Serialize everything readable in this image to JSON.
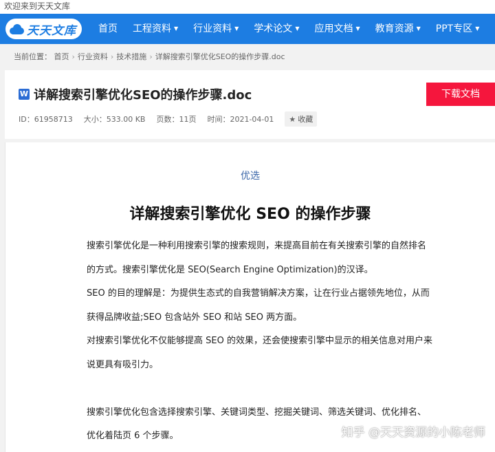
{
  "welcome": "欢迎来到天天文库",
  "logo": {
    "text": "天天文库"
  },
  "nav": [
    {
      "label": "首页",
      "caret": ""
    },
    {
      "label": "工程资料",
      "caret": "▼"
    },
    {
      "label": "行业资料",
      "caret": "▼"
    },
    {
      "label": "学术论文",
      "caret": "▼"
    },
    {
      "label": "应用文档",
      "caret": "▼"
    },
    {
      "label": "教育资源",
      "caret": "▼"
    },
    {
      "label": "PPT专区",
      "caret": "▼"
    }
  ],
  "breadcrumb": {
    "prefix": "当前位置：",
    "items": [
      "首页",
      "行业资料",
      "技术措施",
      "详解搜索引擎优化SEO的操作步骤.doc"
    ],
    "sep": "›"
  },
  "doc": {
    "icon_letter": "W",
    "title": "详解搜索引擎优化SEO的操作步骤.doc",
    "meta": {
      "id": "ID：61958713",
      "size": "大小：533.00 KB",
      "pages": "页数：11页",
      "time": "时间：2021-04-01"
    },
    "fav_label": "收藏",
    "download_label": "下载文档"
  },
  "article": {
    "tag": "优选",
    "title": "详解搜索引擎优化 SEO 的操作步骤",
    "lines": [
      "搜索引擎优化是一种利用搜索引擎的搜索规则，来提高目前在有关搜索引擎的自然排名",
      "的方式。搜索引擎优化是 SEO(Search Engine Optimization)的汉译。",
      "SEO 的目的理解是：为提供生态式的自我营销解决方案，让在行业占据领先地位，从而",
      "获得品牌收益;SEO 包含站外 SEO 和站 SEO 两方面。",
      "对搜索引擎优化不仅能够提高 SEO 的效果，还会使搜索引擎中显示的相关信息对用户来",
      "说更具有吸引力。",
      "",
      "搜索引擎优化包含选择搜索引擎、关键词类型、挖掘关键词、筛选关键词、优化排名、",
      "优化着陆页 6 个步骤。"
    ]
  },
  "watermark": "知乎 @天天资源的小陈老师"
}
